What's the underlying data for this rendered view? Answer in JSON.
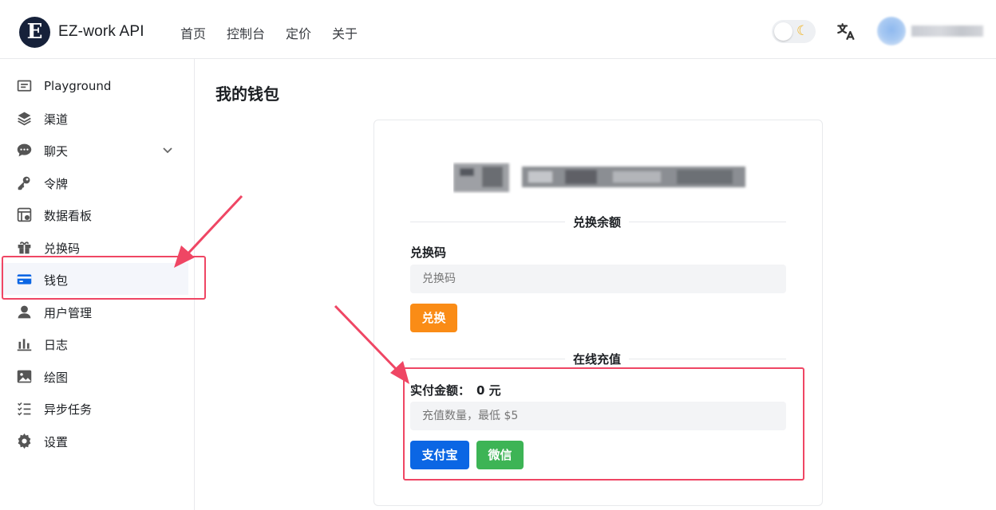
{
  "header": {
    "logo_letter": "E",
    "brand": "EZ-work API",
    "nav": [
      "首页",
      "控制台",
      "定价",
      "关于"
    ],
    "theme_icon": "moon-icon",
    "lang_icon": "translate-icon"
  },
  "sidebar": {
    "items": [
      {
        "label": "Playground",
        "icon": "chat-box-icon"
      },
      {
        "label": "渠道",
        "icon": "layers-icon"
      },
      {
        "label": "聊天",
        "icon": "chat-bubble-icon"
      },
      {
        "label": "令牌",
        "icon": "key-icon"
      },
      {
        "label": "数据看板",
        "icon": "dashboard-icon"
      },
      {
        "label": "兑换码",
        "icon": "gift-icon"
      },
      {
        "label": "钱包",
        "icon": "credit-card-icon"
      },
      {
        "label": "用户管理",
        "icon": "user-icon"
      },
      {
        "label": "日志",
        "icon": "bar-chart-icon"
      },
      {
        "label": "绘图",
        "icon": "image-icon"
      },
      {
        "label": "异步任务",
        "icon": "task-list-icon"
      },
      {
        "label": "设置",
        "icon": "gear-icon"
      }
    ],
    "active_index": 6
  },
  "main": {
    "title": "我的钱包",
    "redeem": {
      "section_title": "兑换余额",
      "field_label": "兑换码",
      "placeholder": "兑换码",
      "button": "兑换"
    },
    "topup": {
      "section_title": "在线充值",
      "amount_label": "实付金额：",
      "amount_value": "0 元",
      "placeholder": "充值数量，最低 $5",
      "alipay": "支付宝",
      "wechat": "微信"
    }
  },
  "colors": {
    "accent": "#0b66e4",
    "redeem": "#fa8c16",
    "wechat": "#3db455",
    "annotation": "#ef4664"
  }
}
